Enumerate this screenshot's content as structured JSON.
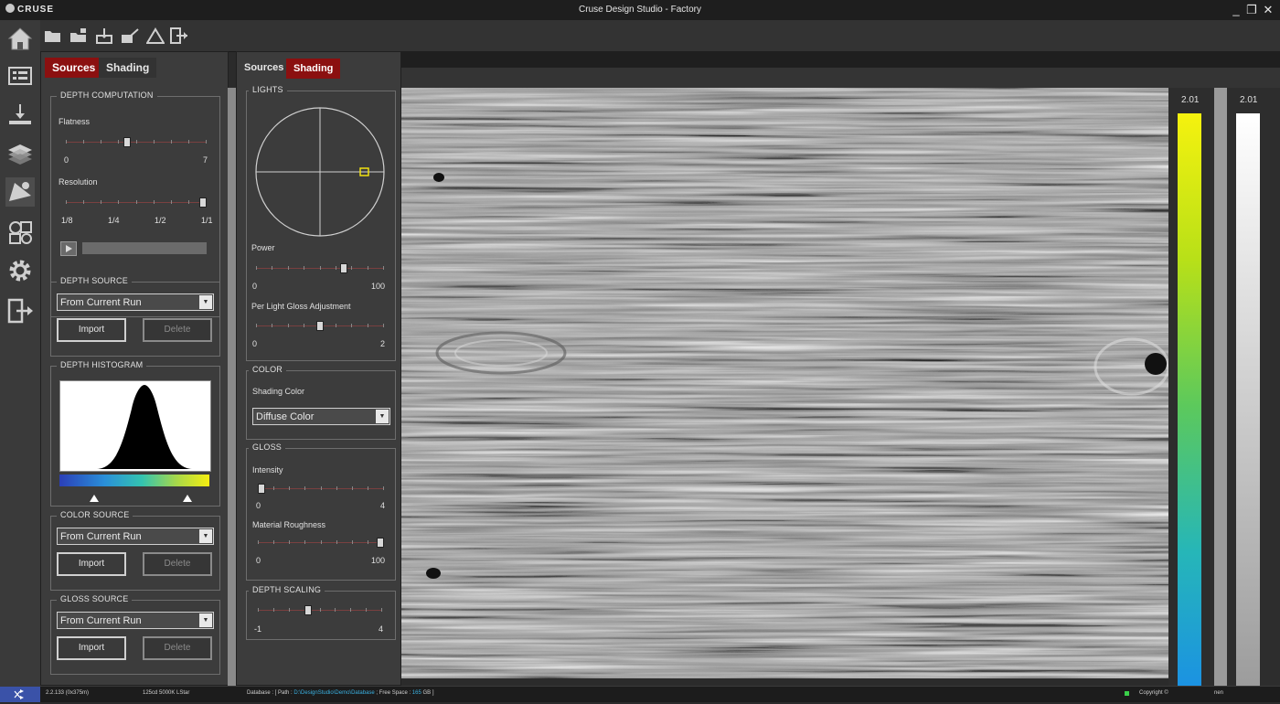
{
  "app": {
    "logo_text": "CRUSE",
    "title": "Cruse Design Studio - Factory"
  },
  "window_controls": {
    "minimize": "_",
    "maximize": "❐",
    "close": "✕"
  },
  "toolbar": {
    "icons": [
      "open-folder-icon",
      "add-folder-icon",
      "download-icon",
      "edit-icon",
      "warning-icon",
      "export-icon"
    ]
  },
  "leftnav": {
    "items": [
      "home-icon",
      "monitor-icon",
      "scan-icon",
      "layers-icon",
      "shading-icon",
      "color-swatch-icon",
      "settings-gear-icon",
      "exit-icon"
    ],
    "active_index": 4
  },
  "left_panel": {
    "tabs": [
      "Sources",
      "Shading"
    ],
    "active_tab": "Sources",
    "depth_computation": {
      "title": "DEPTH COMPUTATION",
      "flatness_label": "Flatness",
      "flatness_min": "0",
      "flatness_max": "7",
      "flatness_value": 0.43,
      "resolution_label": "Resolution",
      "resolution_ticks": [
        "1/8",
        "1/4",
        "1/2",
        "1/1"
      ],
      "resolution_value": 1.0
    },
    "depth_source": {
      "title": "DEPTH SOURCE",
      "selected": "From Current Run",
      "import_label": "Import",
      "delete_label": "Delete"
    },
    "depth_histogram": {
      "title": "DEPTH HISTOGRAM"
    },
    "color_source": {
      "title": "COLOR SOURCE",
      "selected": "From Current Run",
      "import_label": "Import",
      "delete_label": "Delete"
    },
    "gloss_source": {
      "title": "GLOSS SOURCE",
      "selected": "From Current Run",
      "import_label": "Import",
      "delete_label": "Delete"
    }
  },
  "right_panel": {
    "tabs": [
      "Sources",
      "Shading"
    ],
    "active_tab": "Shading",
    "lights": {
      "title": "LIGHTS",
      "power_label": "Power",
      "power_min": "0",
      "power_max": "100",
      "power_value": 0.7,
      "gloss_adj_label": "Per Light Gloss Adjustment",
      "gloss_adj_min": "0",
      "gloss_adj_max": "2",
      "gloss_adj_value": 0.5
    },
    "color": {
      "title": "COLOR",
      "shading_color_label": "Shading Color",
      "selected": "Diffuse Color"
    },
    "gloss": {
      "title": "GLOSS",
      "intensity_label": "Intensity",
      "intensity_min": "0",
      "intensity_max": "4",
      "intensity_value": 0.0,
      "roughness_label": "Material Roughness",
      "roughness_min": "0",
      "roughness_max": "100",
      "roughness_value": 1.0
    },
    "depth_scaling": {
      "title": "DEPTH SCALING",
      "min": "-1",
      "max": "4",
      "value": 0.4
    }
  },
  "colorbars": {
    "left_value": "2.01",
    "right_value": "2.01",
    "partial_text": "nen"
  },
  "status": {
    "coords": "2.2.133 (0x375m)",
    "device": "125cd 5000K LStar",
    "database_label": "Database : [ Path : ",
    "database_path": "D:\\DesignStudio\\Demo\\Database",
    "free_space_label": " ; Free Space : ",
    "free_space_value": "165",
    "free_space_unit": " GB ]",
    "copyright": "Copyright ©"
  }
}
